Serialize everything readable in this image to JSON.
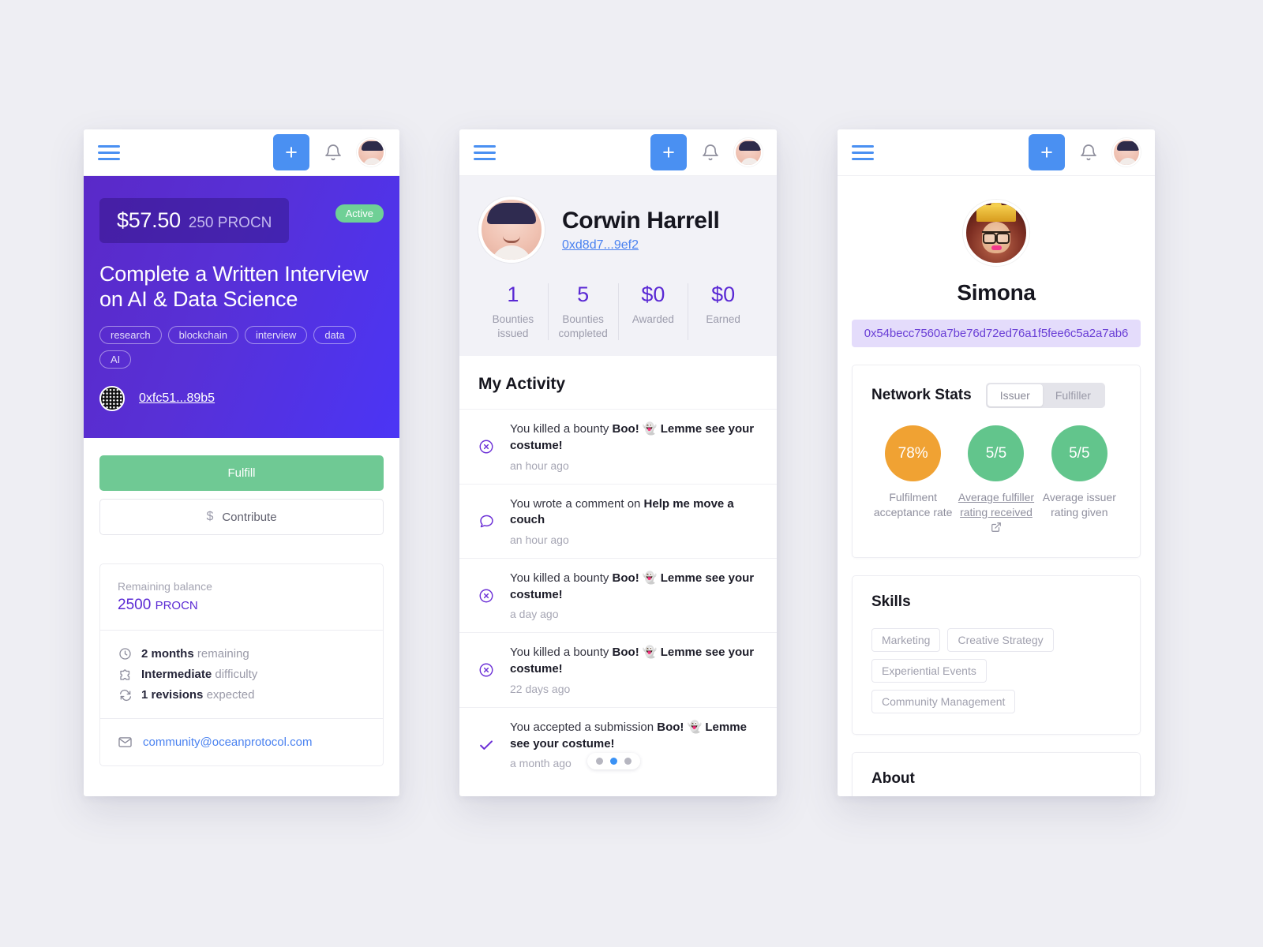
{
  "colors": {
    "accent_blue": "#4a90f2",
    "purple": "#5a29d4",
    "green": "#6fc994",
    "orange": "#f0a233",
    "page_bg": "#eeeef3"
  },
  "nav": {
    "menu_icon": "hamburger-icon",
    "create_label": "+",
    "bell_icon": "bell-icon",
    "avatar_icon": "user-avatar"
  },
  "bounty": {
    "price_usd": "$57.50",
    "price_token": "250 PROCN",
    "status": "Active",
    "title": "Complete a Written Interview on AI & Data Science",
    "tags": [
      "research",
      "blockchain",
      "interview",
      "data",
      "AI"
    ],
    "issuer_address": "0xfc51...89b5",
    "fulfill_label": "Fulfill",
    "contribute_label": "Contribute",
    "contribute_icon": "dollar-icon",
    "balance_label": "Remaining balance",
    "balance_value": "2500",
    "balance_unit": "PROCN",
    "meta": [
      {
        "icon": "clock-icon",
        "strong": "2 months",
        "rest": "remaining"
      },
      {
        "icon": "puzzle-icon",
        "strong": "Intermediate",
        "rest": "difficulty"
      },
      {
        "icon": "revision-icon",
        "strong": "1 revisions",
        "rest": "expected"
      }
    ],
    "email_icon": "envelope-icon",
    "email": "community@oceanprotocol.com"
  },
  "profile": {
    "name": "Corwin Harrell",
    "address": "0xd8d7...9ef2",
    "stats": [
      {
        "value": "1",
        "label": "Bounties issued"
      },
      {
        "value": "5",
        "label": "Bounties completed"
      },
      {
        "value": "$0",
        "label": "Awarded"
      },
      {
        "value": "$0",
        "label": "Earned"
      }
    ],
    "activity_title": "My Activity",
    "activity": [
      {
        "icon": "killed-icon",
        "lead": "You killed a bounty ",
        "strong": "Boo! 👻 Lemme see your costume!",
        "time": "an hour ago"
      },
      {
        "icon": "comment-icon",
        "lead": "You wrote a comment on ",
        "strong": "Help me move a couch",
        "time": "an hour ago"
      },
      {
        "icon": "killed-icon",
        "lead": "You killed a bounty ",
        "strong": "Boo! 👻 Lemme see your costume!",
        "time": "a day ago"
      },
      {
        "icon": "killed-icon",
        "lead": "You killed a bounty ",
        "strong": "Boo! 👻 Lemme see your costume!",
        "time": "22 days ago"
      },
      {
        "icon": "check-icon",
        "lead": "You accepted a submission ",
        "strong": "Boo! 👻 Lemme see your costume!",
        "time": "a month ago"
      }
    ],
    "pager": {
      "dots": 3,
      "active_index": 1
    }
  },
  "user": {
    "name": "Simona",
    "address": "0x54becc7560a7be76d72ed76a1f5fee6c5a2a7ab6",
    "network_stats": {
      "title": "Network Stats",
      "toggle": {
        "options": [
          "Issuer",
          "Fulfiller"
        ],
        "selected": "Issuer"
      },
      "circles": [
        {
          "value": "78%",
          "label": "Fulfilment acceptance rate",
          "color": "#f0a233",
          "link": false
        },
        {
          "value": "5/5",
          "label": "Average fulfiller rating received",
          "color": "#62c58c",
          "link": true
        },
        {
          "value": "5/5",
          "label": "Average issuer rating given",
          "color": "#62c58c",
          "link": false
        }
      ]
    },
    "skills": {
      "title": "Skills",
      "items": [
        "Marketing",
        "Creative Strategy",
        "Experiential Events",
        "Community Management"
      ]
    },
    "about": {
      "title": "About"
    }
  }
}
